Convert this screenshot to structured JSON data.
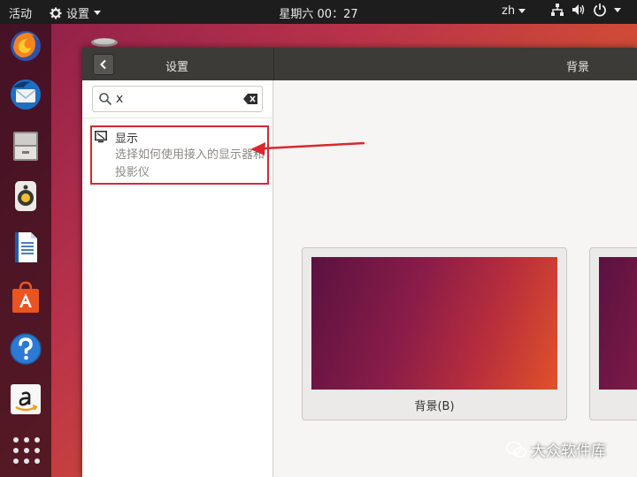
{
  "topbar": {
    "activities": "活动",
    "app_menu": "设置",
    "clock": "星期六 00：27",
    "lang": "zh"
  },
  "window": {
    "title": "设置",
    "panel_title": "背景"
  },
  "search": {
    "value": "x"
  },
  "result": {
    "title": "显示",
    "description": "选择如何使用接入的显示器和投影仪"
  },
  "cards": [
    {
      "label": "背景(B)"
    },
    {
      "label": ""
    }
  ],
  "watermark": "大众软件库",
  "colors": {
    "highlight": "#d9282f",
    "titlebar": "#3c3b37",
    "topbar": "#1d1d1d"
  }
}
